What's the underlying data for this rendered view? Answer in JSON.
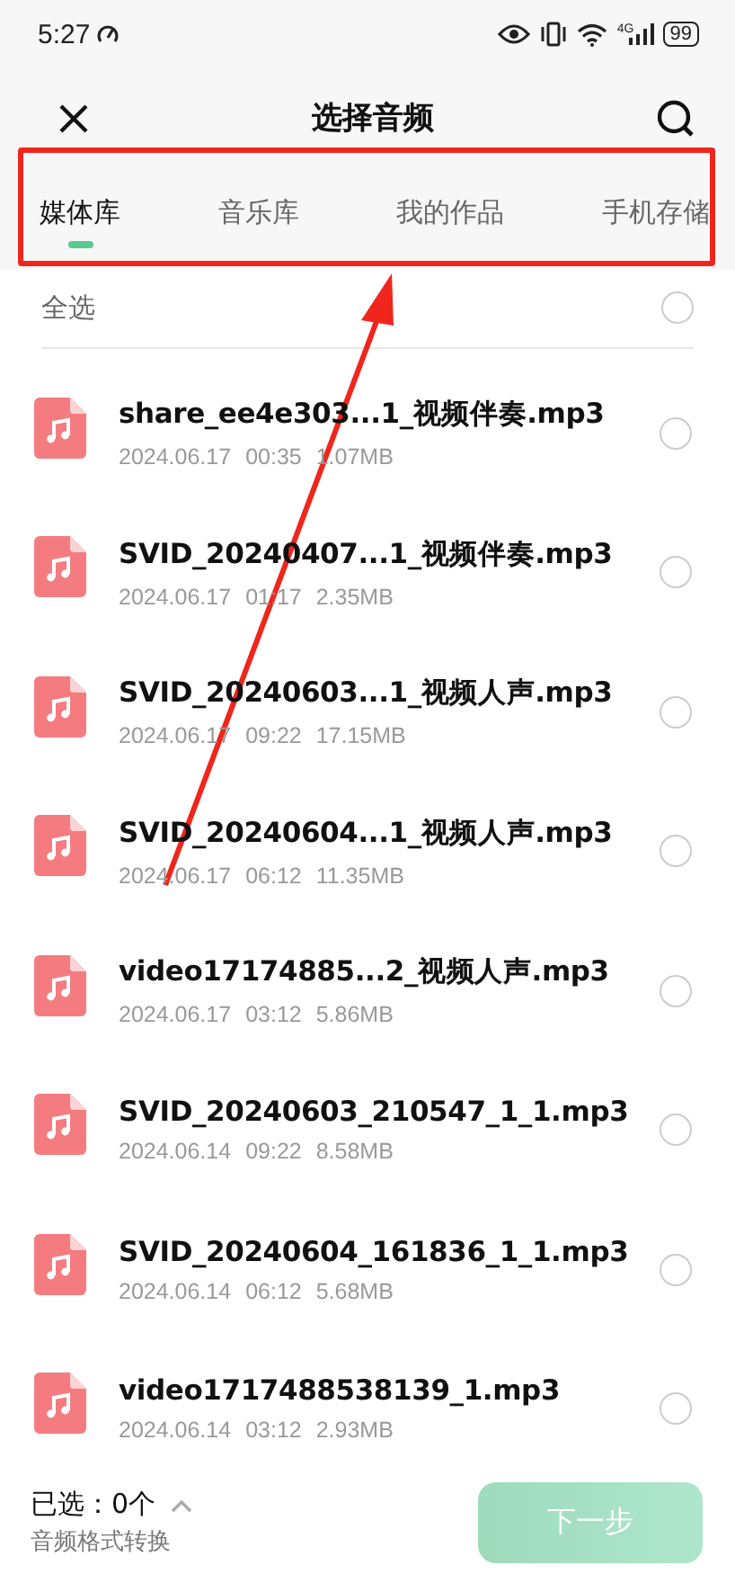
{
  "status_bar": {
    "time": "5:27",
    "network": "4G",
    "battery": "99"
  },
  "header": {
    "title": "选择音频"
  },
  "tabs": [
    {
      "label": "媒体库",
      "selected": true
    },
    {
      "label": "音乐库",
      "selected": false
    },
    {
      "label": "我的作品",
      "selected": false
    },
    {
      "label": "手机存储",
      "selected": false
    }
  ],
  "select_all": {
    "label": "全选",
    "checked": false
  },
  "files": [
    {
      "name": "share_ee4e303...1_视频伴奏.mp3",
      "date": "2024.06.17",
      "time": "00:35",
      "size": "1.07MB",
      "selected": false
    },
    {
      "name": "SVID_20240407...1_视频伴奏.mp3",
      "date": "2024.06.17",
      "time": "01:17",
      "size": "2.35MB",
      "selected": false
    },
    {
      "name": "SVID_20240603...1_视频人声.mp3",
      "date": "2024.06.17",
      "time": "09:22",
      "size": "17.15MB",
      "selected": false
    },
    {
      "name": "SVID_20240604...1_视频人声.mp3",
      "date": "2024.06.17",
      "time": "06:12",
      "size": "11.35MB",
      "selected": false
    },
    {
      "name": "video17174885...2_视频人声.mp3",
      "date": "2024.06.17",
      "time": "03:12",
      "size": "5.86MB",
      "selected": false
    },
    {
      "name": "SVID_20240603_210547_1_1.mp3",
      "date": "2024.06.14",
      "time": "09:22",
      "size": "8.58MB",
      "selected": false
    },
    {
      "name": "SVID_20240604_161836_1_1.mp3",
      "date": "2024.06.14",
      "time": "06:12",
      "size": "5.68MB",
      "selected": false
    },
    {
      "name": "video1717488538139_1.mp3",
      "date": "2024.06.14",
      "time": "03:12",
      "size": "2.93MB",
      "selected": false
    }
  ],
  "footer": {
    "selected_count": "已选：0个",
    "format_link": "音频格式转换",
    "next_button": {
      "label": "下一步",
      "disabled": true
    }
  }
}
